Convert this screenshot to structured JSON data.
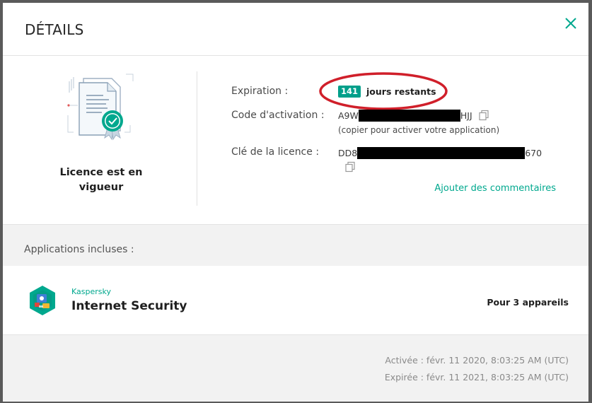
{
  "dialog": {
    "title": "DÉTAILS",
    "close_icon": "close-icon"
  },
  "license": {
    "illustration_icon": "license-certificate-icon",
    "status": "Licence est en vigueur"
  },
  "fields": {
    "expiration_label": "Expiration :",
    "days_remaining": "141",
    "days_remaining_text": "jours restants",
    "activation_code_label": "Code d'activation :",
    "activation_code_prefix": "A9W",
    "activation_code_suffix": "HJJ",
    "activation_code_hint": "(copier pour activer votre application)",
    "license_key_label": "Clé de la licence :",
    "license_key_prefix": "DD8",
    "license_key_suffix": "670",
    "copy_icon": "copy-icon",
    "add_comments": "Ajouter des commentaires"
  },
  "applications": {
    "label": "Applications incluses :",
    "items": [
      {
        "vendor": "Kaspersky",
        "name": "Internet Security",
        "devices": "Pour 3 appareils",
        "icon": "kaspersky-internet-security-icon"
      }
    ]
  },
  "dates": {
    "activated": "Activée : févr. 11 2020, 8:03:25 AM (UTC)",
    "expired": "Expirée : févr. 11 2021, 8:03:25 AM (UTC)"
  },
  "colors": {
    "accent": "#00a88e",
    "badge": "#009f8a",
    "annotation": "#d01f2a"
  }
}
